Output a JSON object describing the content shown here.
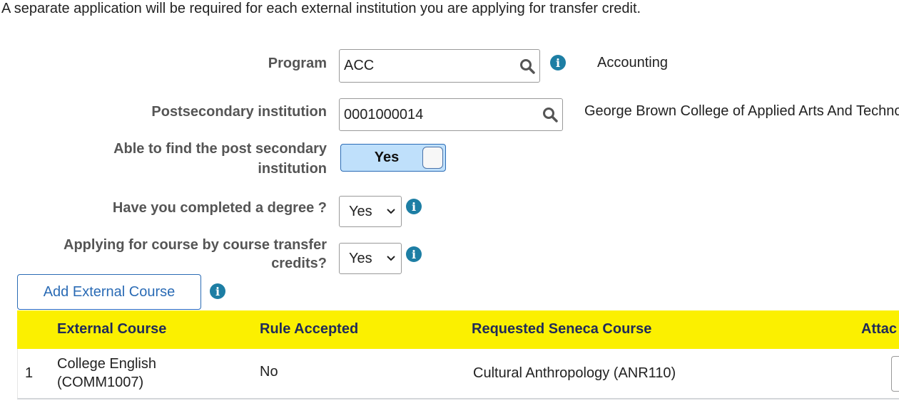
{
  "intro": "A separate application will be required for each external institution you are applying for transfer credit.",
  "form": {
    "program": {
      "label": "Program",
      "value": "ACC",
      "description": "Accounting"
    },
    "institution": {
      "label": "Postsecondary institution",
      "value": "0001000014",
      "description": "George Brown College of Applied Arts And Technology"
    },
    "able_to_find": {
      "label_line1": "Able to find the post secondary",
      "label_line2": "institution",
      "value": "Yes",
      "on": true
    },
    "degree": {
      "label": "Have you completed a degree ?",
      "value": "Yes"
    },
    "course_by_course": {
      "label_line1": "Applying for course by course transfer",
      "label_line2": "credits?",
      "value": "Yes"
    }
  },
  "add_button": "Add External Course",
  "table": {
    "headers": [
      "External Course",
      "Rule Accepted",
      "Requested Seneca Course",
      "Attac"
    ],
    "header_color": "#fbf000",
    "rows": [
      {
        "num": "1",
        "external_line1": "College English",
        "external_line2": "(COMM1007)",
        "rule": "No",
        "requested": "Cultural Anthropology (ANR110)"
      }
    ]
  }
}
